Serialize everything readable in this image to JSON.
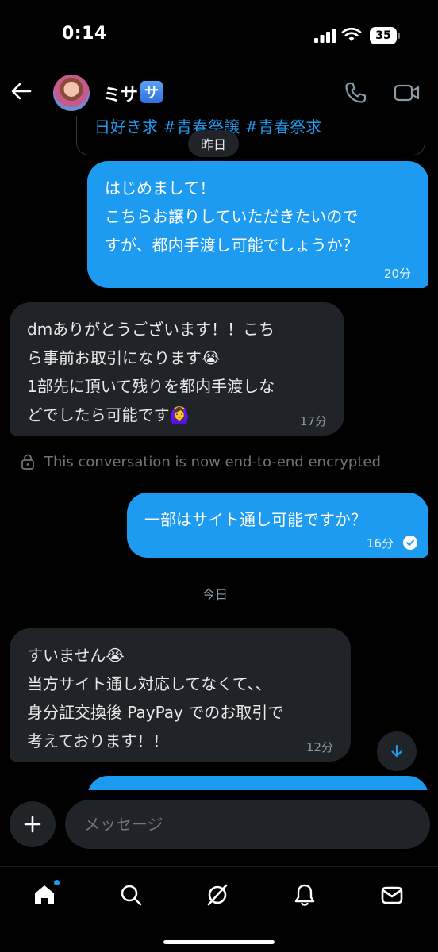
{
  "status_bar": {
    "time": "0:14",
    "battery": "35"
  },
  "header": {
    "contact_name": "ミサ",
    "name_badge": "サ"
  },
  "chat": {
    "quoted_text": "日好き求 #青春祭譲 #青春祭求",
    "date_yesterday": "昨日",
    "date_today": "今日",
    "messages": [
      {
        "direction": "out",
        "lines": [
          "はじめまして！",
          "こちらお譲りしていただきたいので",
          "すが、都内手渡し可能でしょうか？"
        ],
        "time": "20分"
      },
      {
        "direction": "in",
        "lines": [
          "dmありがとうございます！！こち",
          "ら事前お取引になります😭",
          "1部先に頂いて残りを都内手渡しな",
          "どでしたら可能です🙆‍♀️"
        ],
        "time": "17分"
      },
      {
        "direction": "out",
        "lines": [
          "一部はサイト通し可能ですか？"
        ],
        "time": "16分"
      },
      {
        "direction": "in",
        "lines": [
          "すいません😭",
          "当方サイト通し対応してなくて、、",
          "身分証交換後 PayPay でのお取引で",
          "考えております！！"
        ],
        "time": "12分"
      }
    ],
    "encryption_notice": "This conversation is now end-to-end encrypted"
  },
  "composer": {
    "placeholder": "メッセージ"
  },
  "colors": {
    "accent": "#1d9bf0",
    "incoming_bubble": "#202327",
    "background": "#000000"
  },
  "icons": [
    "back-arrow-icon",
    "phone-icon",
    "video-icon",
    "lock-icon",
    "read-check-icon",
    "arrow-down-icon",
    "plus-icon",
    "home-icon",
    "search-icon",
    "grok-icon",
    "bell-icon",
    "mail-icon"
  ]
}
